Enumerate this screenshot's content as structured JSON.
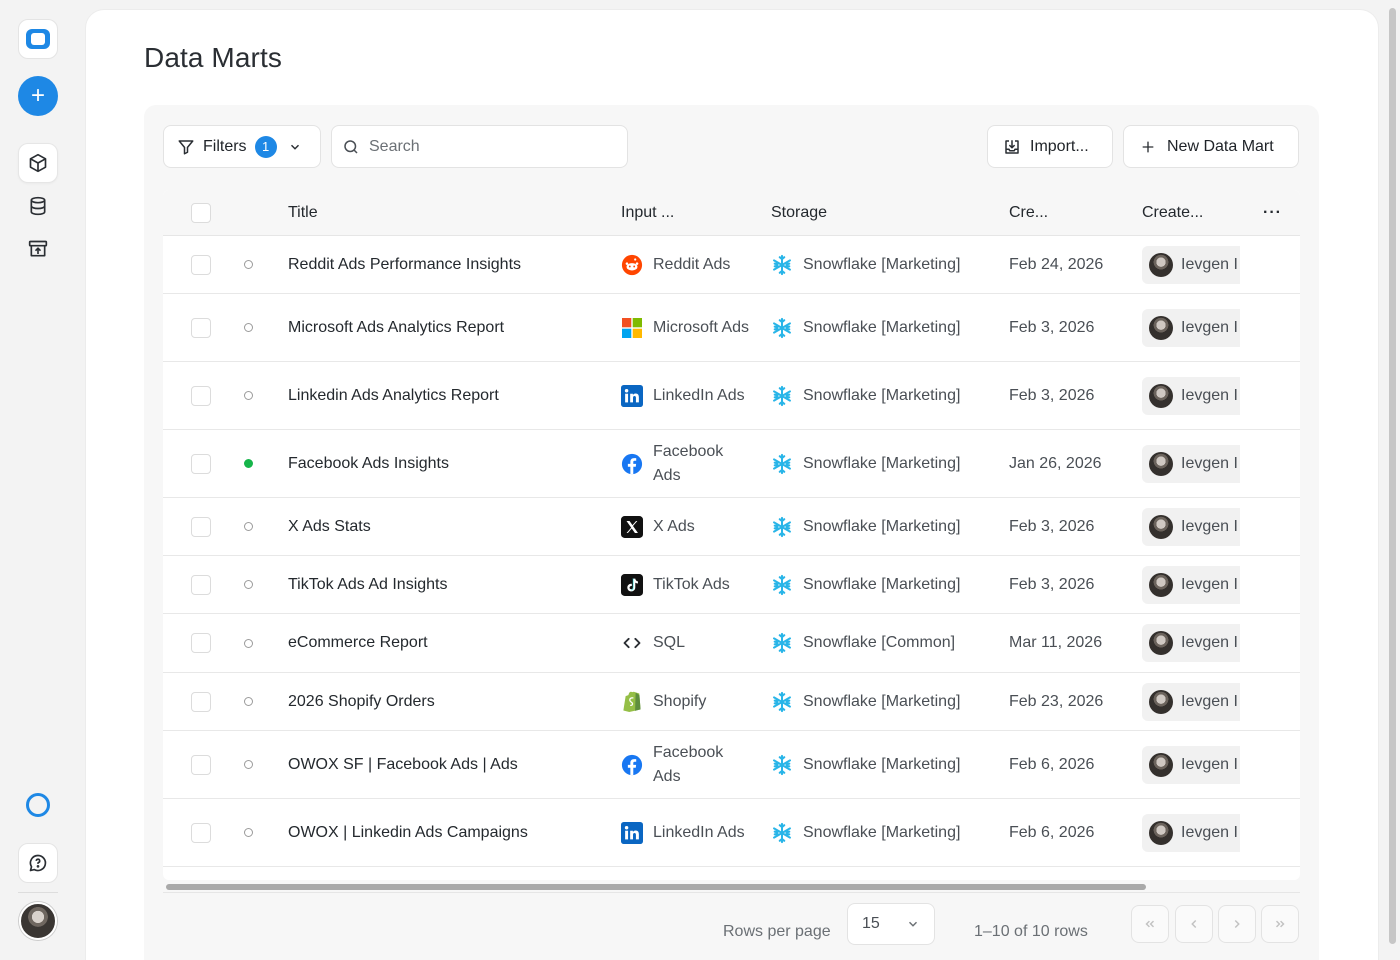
{
  "page": {
    "title": "Data Marts"
  },
  "sidebar": {
    "items": [
      {
        "name": "logo"
      },
      {
        "name": "add",
        "glyph": "+"
      },
      {
        "name": "data-marts"
      },
      {
        "name": "storages"
      },
      {
        "name": "destinations"
      },
      {
        "name": "status"
      },
      {
        "name": "chat"
      },
      {
        "name": "user-avatar"
      }
    ]
  },
  "toolbar": {
    "filters_label": "Filters",
    "filters_count": "1",
    "search_placeholder": "Search",
    "import_label": "Import...",
    "new_label": "New Data Mart"
  },
  "table": {
    "headers": {
      "title": "Title",
      "input": "Input ...",
      "storage": "Storage",
      "created": "Cre...",
      "creator": "Create...",
      "more": "···"
    },
    "rows": [
      {
        "title": "Reddit Ads Performance Insights",
        "source": "Reddit Ads",
        "source_icon": "reddit-icon",
        "storage": "Snowflake [Marketing]",
        "created": "Feb 24, 2026",
        "owner": "Ievgen I",
        "status": "inactive"
      },
      {
        "title": "Microsoft Ads Analytics Report",
        "source": "Microsoft Ads",
        "source_icon": "microsoft-icon",
        "storage": "Snowflake [Marketing]",
        "created": "Feb 3, 2026",
        "owner": "Ievgen I",
        "status": "inactive"
      },
      {
        "title": "Linkedin Ads Analytics Report",
        "source": "LinkedIn Ads",
        "source_icon": "linkedin-icon",
        "storage": "Snowflake [Marketing]",
        "created": "Feb 3, 2026",
        "owner": "Ievgen I",
        "status": "inactive"
      },
      {
        "title": "Facebook Ads Insights",
        "source": "Facebook Ads",
        "source_icon": "facebook-icon",
        "storage": "Snowflake [Marketing]",
        "created": "Jan 26, 2026",
        "owner": "Ievgen I",
        "status": "active"
      },
      {
        "title": "X Ads Stats",
        "source": "X Ads",
        "source_icon": "x-icon",
        "storage": "Snowflake [Marketing]",
        "created": "Feb 3, 2026",
        "owner": "Ievgen I",
        "status": "inactive"
      },
      {
        "title": "TikTok Ads Ad Insights",
        "source": "TikTok Ads",
        "source_icon": "tiktok-icon",
        "storage": "Snowflake [Marketing]",
        "created": "Feb 3, 2026",
        "owner": "Ievgen I",
        "status": "inactive"
      },
      {
        "title": "eCommerce Report",
        "source": "SQL",
        "source_icon": "code-icon",
        "storage": "Snowflake [Common]",
        "created": "Mar 11, 2026",
        "owner": "Ievgen I",
        "status": "inactive"
      },
      {
        "title": "2026 Shopify Orders",
        "source": "Shopify",
        "source_icon": "shopify-icon",
        "storage": "Snowflake [Marketing]",
        "created": "Feb 23, 2026",
        "owner": "Ievgen I",
        "status": "inactive"
      },
      {
        "title": "OWOX SF | Facebook Ads | Ads",
        "source": "Facebook Ads",
        "source_icon": "facebook-icon",
        "storage": "Snowflake [Marketing]",
        "created": "Feb 6, 2026",
        "owner": "Ievgen I",
        "status": "inactive"
      },
      {
        "title": "OWOX | Linkedin Ads Campaigns",
        "source": "LinkedIn Ads",
        "source_icon": "linkedin-icon",
        "storage": "Snowflake [Marketing]",
        "created": "Feb 6, 2026",
        "owner": "Ievgen I",
        "status": "inactive"
      }
    ]
  },
  "pagination": {
    "rows_per_page_label": "Rows per page",
    "rows_per_page_value": "15",
    "range_text": "1–10 of 10 rows"
  },
  "colors": {
    "accent": "#1e88e5",
    "active_status": "#16b54a",
    "snowflake": "#29b5e8"
  }
}
